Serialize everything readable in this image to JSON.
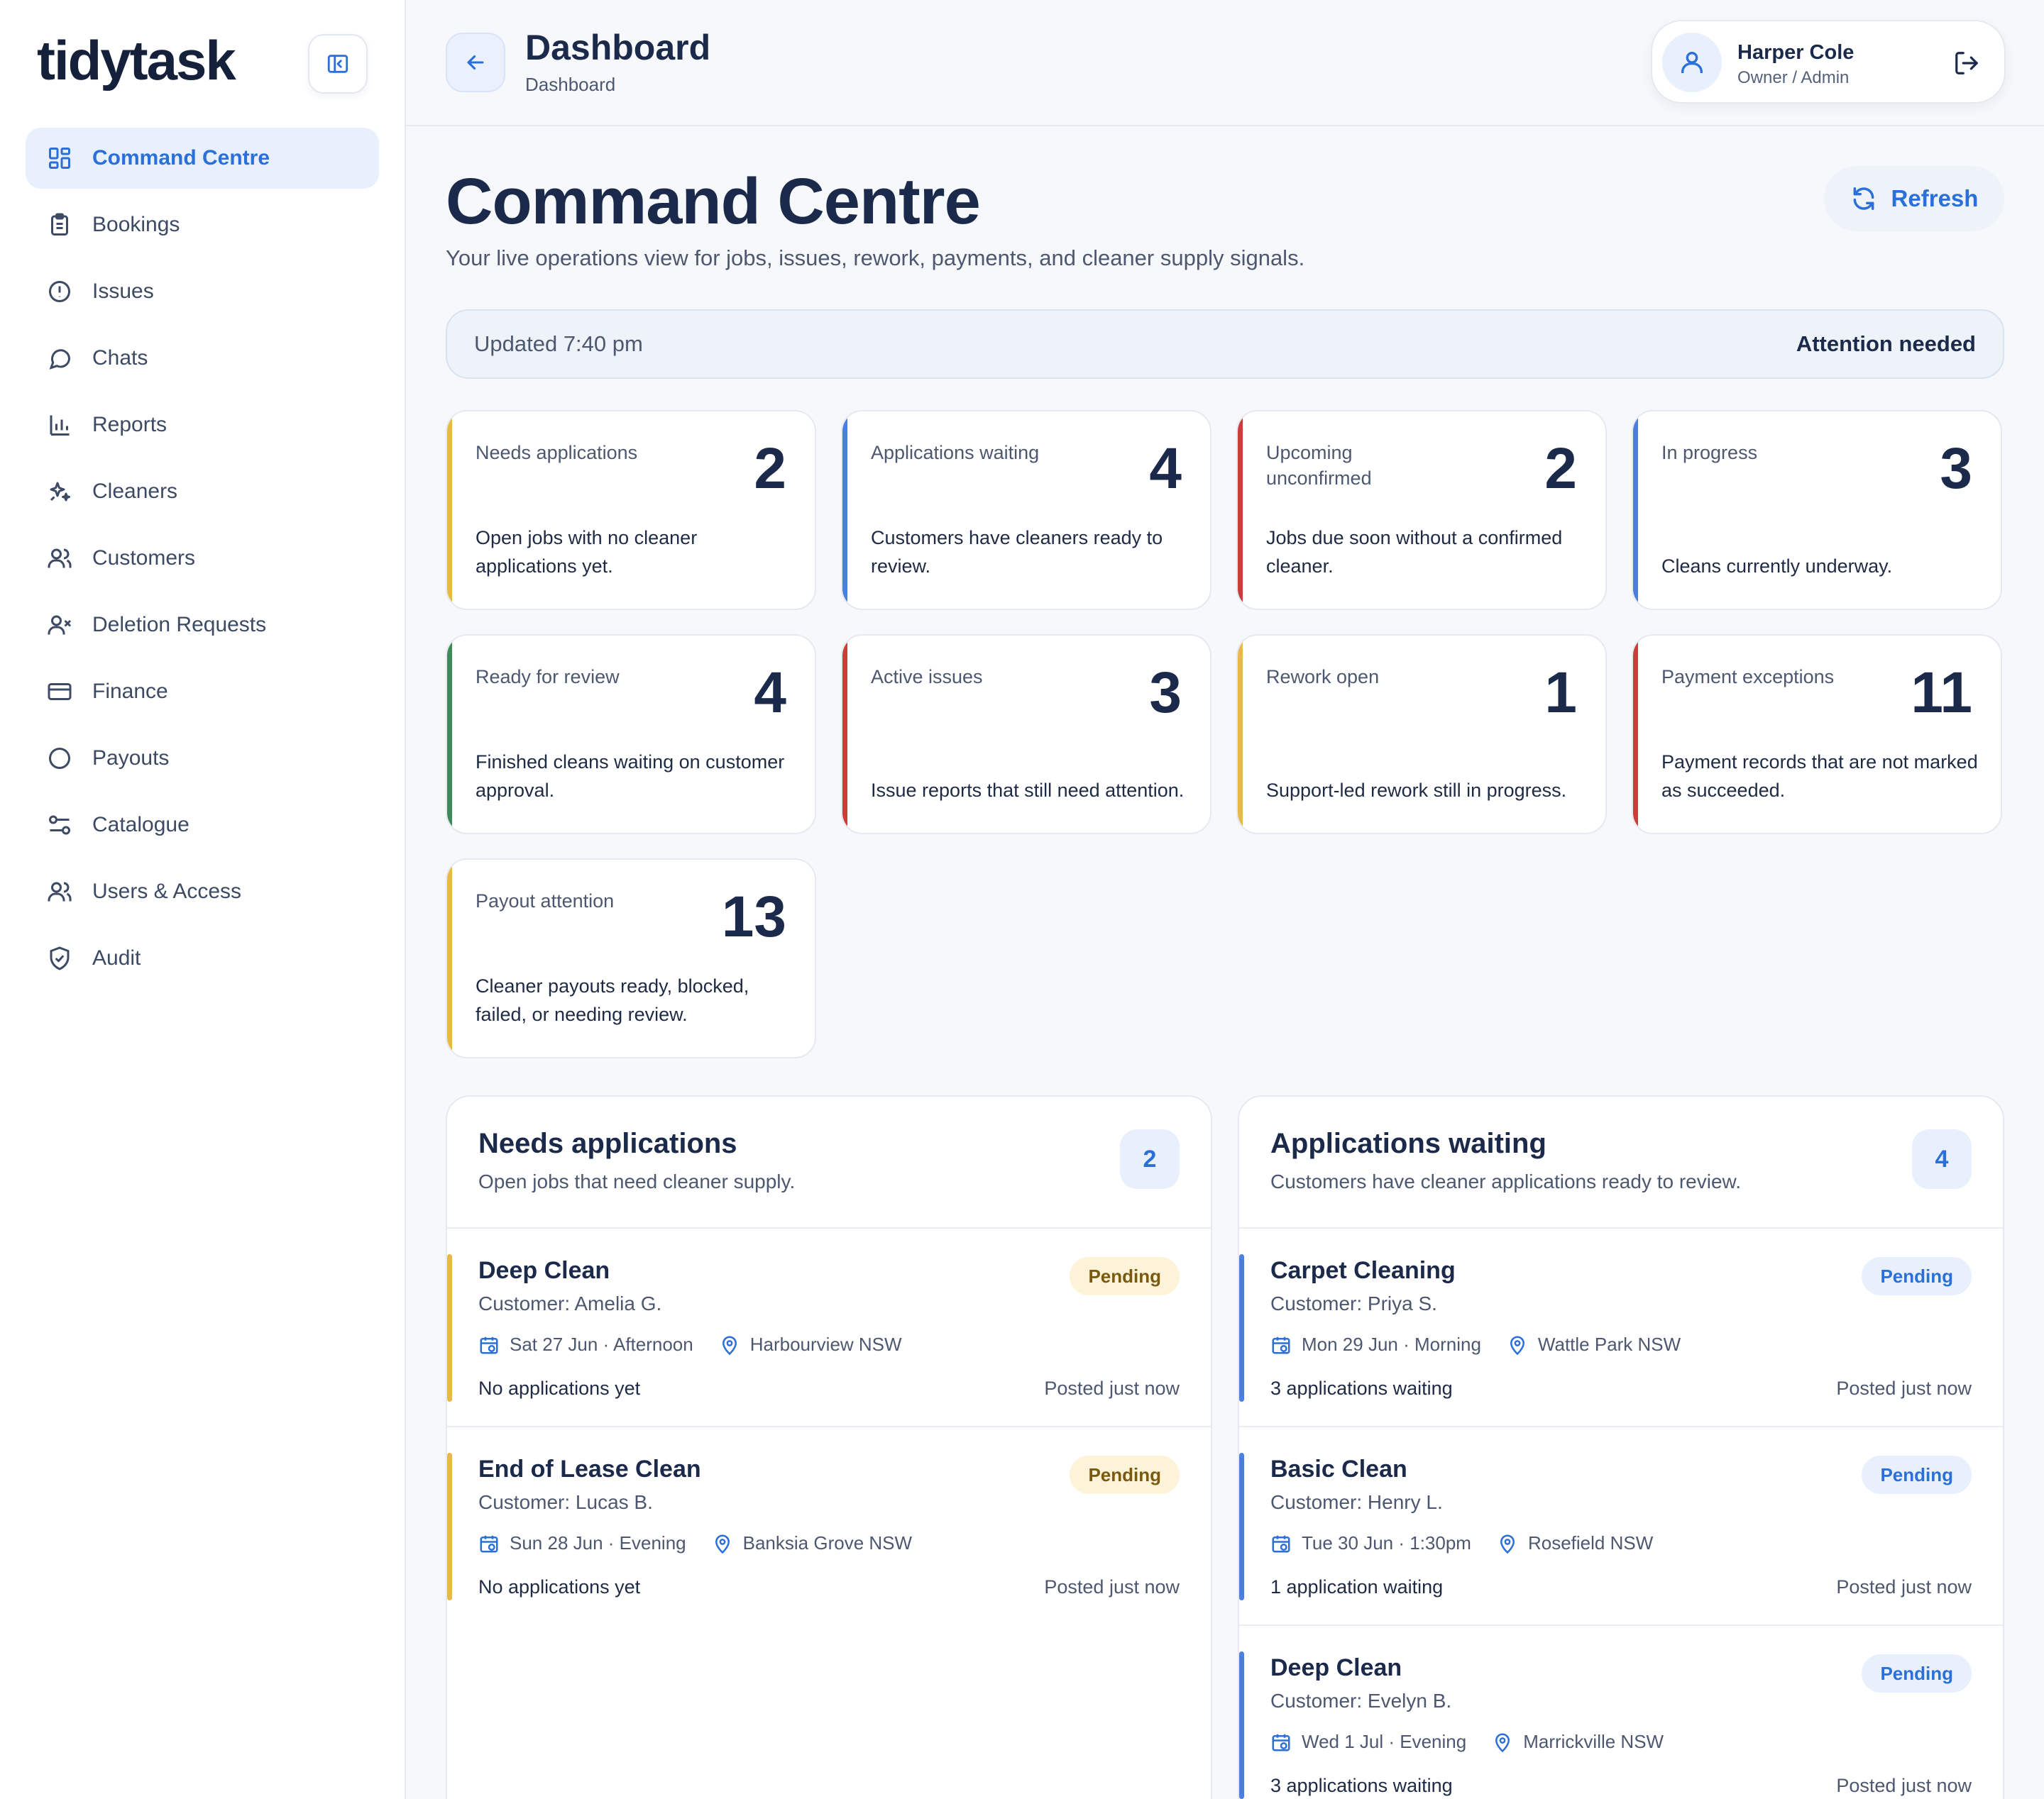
{
  "brand": {
    "logo": "tidytask"
  },
  "colors": {
    "accent": "#2b6fd8",
    "amber": "#e8b84a",
    "blue": "#4a7fe0",
    "red": "#cf3b3b",
    "green": "#3f8a5a"
  },
  "sidebar": {
    "items": [
      {
        "label": "Command Centre",
        "icon": "grid-icon",
        "active": true
      },
      {
        "label": "Bookings",
        "icon": "clipboard-icon"
      },
      {
        "label": "Issues",
        "icon": "alert-circle-icon"
      },
      {
        "label": "Chats",
        "icon": "chat-bubble-icon"
      },
      {
        "label": "Reports",
        "icon": "bar-chart-icon"
      },
      {
        "label": "Cleaners",
        "icon": "sparkles-icon"
      },
      {
        "label": "Customers",
        "icon": "users-icon"
      },
      {
        "label": "Deletion Requests",
        "icon": "user-x-icon"
      },
      {
        "label": "Finance",
        "icon": "credit-card-icon"
      },
      {
        "label": "Payouts",
        "icon": "circle-icon"
      },
      {
        "label": "Catalogue",
        "icon": "sliders-icon"
      },
      {
        "label": "Users & Access",
        "icon": "users-icon"
      },
      {
        "label": "Audit",
        "icon": "shield-check-icon"
      }
    ]
  },
  "header": {
    "title": "Dashboard",
    "breadcrumb": "Dashboard",
    "user": {
      "name": "Harper Cole",
      "role": "Owner / Admin"
    }
  },
  "main": {
    "title": "Command Centre",
    "subtitle": "Your live operations view for jobs, issues, rework, payments, and cleaner supply signals.",
    "refresh_label": "Refresh",
    "status": {
      "updated": "Updated 7:40 pm",
      "attention": "Attention needed"
    },
    "stats": [
      {
        "label": "Needs applications",
        "value": "2",
        "desc": "Open jobs with no cleaner applications yet.",
        "color": "#e8b84a"
      },
      {
        "label": "Applications waiting",
        "value": "4",
        "desc": "Customers have cleaners ready to review.",
        "color": "#4a7fe0"
      },
      {
        "label": "Upcoming unconfirmed",
        "value": "2",
        "desc": "Jobs due soon without a confirmed cleaner.",
        "color": "#cf3b3b"
      },
      {
        "label": "In progress",
        "value": "3",
        "desc": "Cleans currently underway.",
        "color": "#4a7fe0"
      },
      {
        "label": "Ready for review",
        "value": "4",
        "desc": "Finished cleans waiting on customer approval.",
        "color": "#3f8a5a"
      },
      {
        "label": "Active issues",
        "value": "3",
        "desc": "Issue reports that still need attention.",
        "color": "#cf3b3b"
      },
      {
        "label": "Rework open",
        "value": "1",
        "desc": "Support-led rework still in progress.",
        "color": "#e8b84a"
      },
      {
        "label": "Payment exceptions",
        "value": "11",
        "desc": "Payment records that are not marked as succeeded.",
        "color": "#cf3b3b"
      },
      {
        "label": "Payout attention",
        "value": "13",
        "desc": "Cleaner payouts ready, blocked, failed, or needing review.",
        "color": "#e8b84a"
      }
    ],
    "panels": [
      {
        "title": "Needs applications",
        "subtitle": "Open jobs that need cleaner supply.",
        "count": "2",
        "jobs": [
          {
            "title": "Deep Clean",
            "customer": "Customer: Amelia G.",
            "date": "Sat 27 Jun · Afternoon",
            "location": "Harbourview NSW",
            "apps": "No applications yet",
            "posted": "Posted just now",
            "status": "Pending"
          },
          {
            "title": "End of Lease Clean",
            "customer": "Customer: Lucas B.",
            "date": "Sun 28 Jun · Evening",
            "location": "Banksia Grove NSW",
            "apps": "No applications yet",
            "posted": "Posted just now",
            "status": "Pending"
          }
        ]
      },
      {
        "title": "Applications waiting",
        "subtitle": "Customers have cleaner applications ready to review.",
        "count": "4",
        "jobs": [
          {
            "title": "Carpet Cleaning",
            "customer": "Customer: Priya S.",
            "date": "Mon 29 Jun · Morning",
            "location": "Wattle Park NSW",
            "apps": "3 applications waiting",
            "posted": "Posted just now",
            "status": "Pending"
          },
          {
            "title": "Basic Clean",
            "customer": "Customer: Henry L.",
            "date": "Tue 30 Jun · 1:30pm",
            "location": "Rosefield NSW",
            "apps": "1 application waiting",
            "posted": "Posted just now",
            "status": "Pending"
          },
          {
            "title": "Deep Clean",
            "customer": "Customer: Evelyn B.",
            "date": "Wed 1 Jul · Evening",
            "location": "Marrickville NSW",
            "apps": "3 applications waiting",
            "posted": "Posted just now",
            "status": "Pending"
          }
        ]
      }
    ]
  }
}
